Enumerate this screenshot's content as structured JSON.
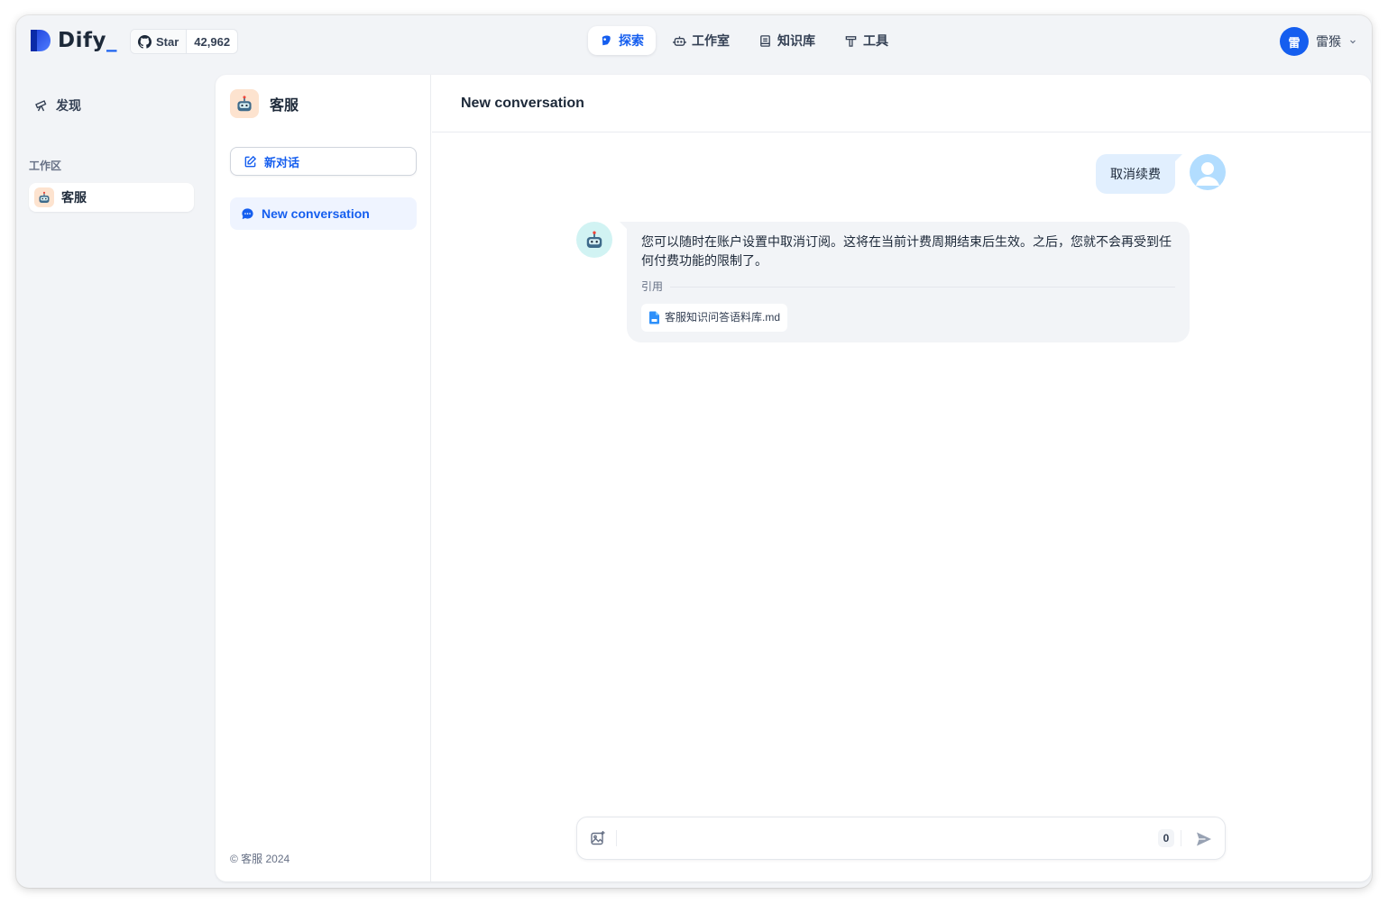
{
  "brand": {
    "name": "Dify",
    "underscore": "_"
  },
  "github": {
    "star_label": "Star",
    "count": "42,962"
  },
  "nav": [
    {
      "label": "探索",
      "icon": "compass-icon",
      "active": true
    },
    {
      "label": "工作室",
      "icon": "robot-icon",
      "active": false
    },
    {
      "label": "知识库",
      "icon": "book-icon",
      "active": false
    },
    {
      "label": "工具",
      "icon": "hammer-icon",
      "active": false
    }
  ],
  "user": {
    "avatar_initial": "雷",
    "name": "雷猴"
  },
  "sidebar": {
    "discover_label": "发现",
    "workspace_label": "工作区",
    "workspace_items": [
      {
        "label": "客服"
      }
    ]
  },
  "app": {
    "name": "客服",
    "new_chat_label": "新对话",
    "conversations": [
      {
        "label": "New conversation",
        "active": true
      }
    ],
    "copyright": "© 客服 2024"
  },
  "chat": {
    "title": "New conversation",
    "messages": [
      {
        "role": "user",
        "text": "取消续费"
      },
      {
        "role": "assistant",
        "text": "您可以随时在账户设置中取消订阅。这将在当前计费周期结束后生效。之后，您就不会再受到任何付费功能的限制了。",
        "citation_label": "引用",
        "citations": [
          "客服知识问答语料库.md"
        ]
      }
    ],
    "input": {
      "value": "",
      "placeholder": "",
      "char_count": "0"
    }
  },
  "colors": {
    "accent": "#155eef",
    "active_bg": "#eff4ff",
    "user_bubble": "#e1effe",
    "bot_bubble": "#f2f4f7"
  }
}
